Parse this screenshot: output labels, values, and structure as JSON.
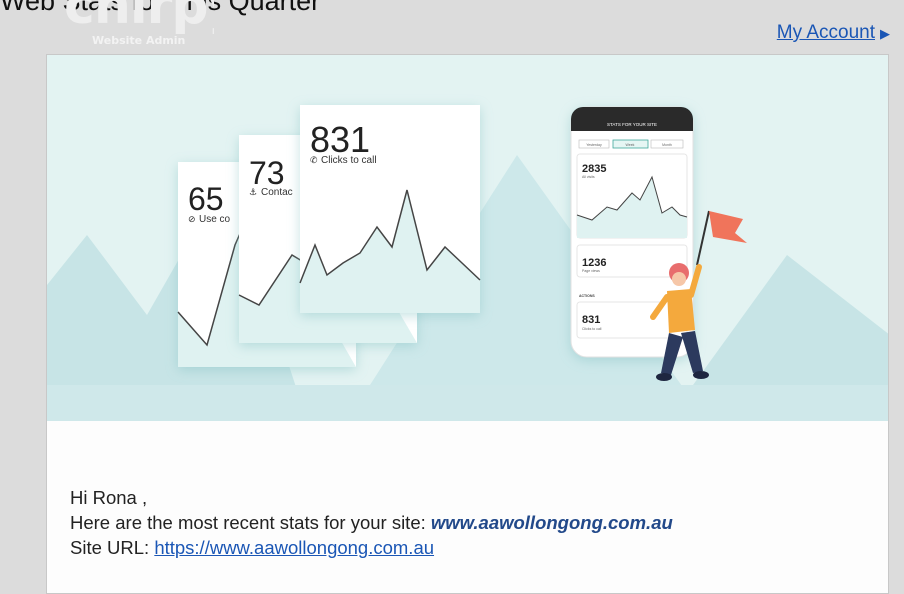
{
  "header": {
    "title_text": "Web Stats for This Quarter",
    "brand_logo": "chirpy",
    "brand_sub": "Website Admin",
    "account_link": "My Account"
  },
  "hero": {
    "cards": [
      {
        "value": "65",
        "label": "Use co"
      },
      {
        "value": "73",
        "label": "Contac"
      },
      {
        "value": "831",
        "label": "Clicks to call"
      }
    ],
    "phone": {
      "header": "STATS FOR YOUR SITE",
      "tabs": [
        "Yesterday",
        "Week",
        "Month"
      ],
      "stat_main_value": "2835",
      "stat_main_label": "All visits",
      "stat_mid_value": "1236",
      "stat_mid_label": "Page views",
      "section_label": "ACTIONS",
      "stat_low_value": "831",
      "stat_low_label": "Clicks to call"
    }
  },
  "body": {
    "greeting": "Hi Rona ,",
    "intro": "Here are the most recent stats for your site:",
    "site_name": "www.aawollongong.com.au",
    "url_label": "Site URL:",
    "url": "https://www.aawollongong.com.au"
  },
  "colors": {
    "hero_bg": "#e3f3f2",
    "mountain": "#c7e4e6",
    "ground": "#cfe8ea",
    "chart_fill": "#dff2f1",
    "flag": "#f0745b",
    "shirt": "#f4a93d",
    "pants": "#2c3a5e",
    "link": "#1a56b5"
  }
}
